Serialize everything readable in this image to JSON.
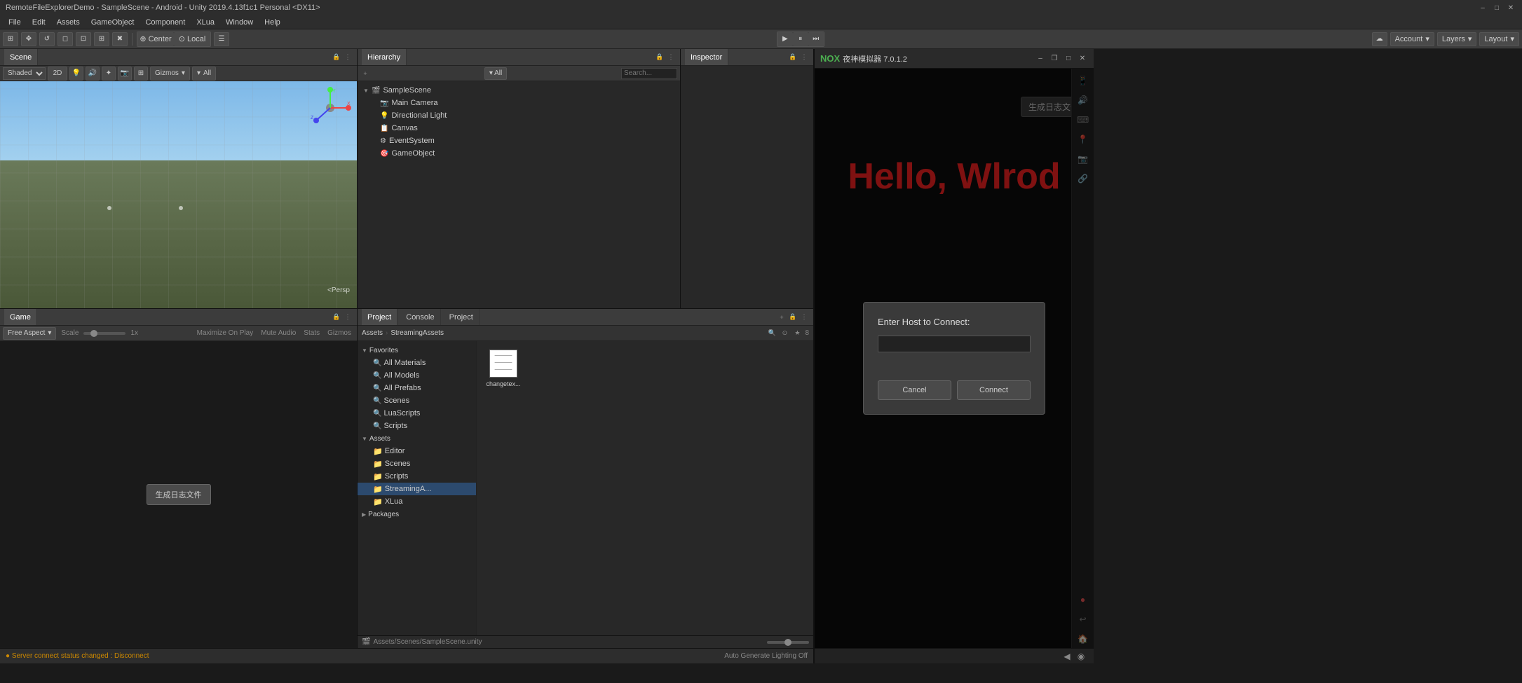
{
  "titlebar": {
    "title": "RemoteFileExplorerDemo - SampleScene - Android - Unity 2019.4.13f1c1 Personal <DX11>",
    "minimize": "–",
    "maximize": "□",
    "close": "✕"
  },
  "menubar": {
    "items": [
      "File",
      "Edit",
      "Assets",
      "GameObject",
      "Component",
      "XLua",
      "Window",
      "Help"
    ]
  },
  "toolbar": {
    "play_label": "▶",
    "pause_label": "⏸",
    "step_label": "⏭",
    "center_label": "Center",
    "local_label": "Local"
  },
  "top_controls": {
    "account_label": "Account",
    "layers_label": "Layers",
    "layout_label": "Layout"
  },
  "scene_panel": {
    "tab_label": "Scene",
    "view_mode": "Shaded",
    "dim": "2D",
    "gizmos_label": "Gizmos",
    "all_label": "All",
    "persp_label": "<Persp"
  },
  "hierarchy_panel": {
    "tab_label": "Hierarchy",
    "items": [
      {
        "label": "SampleScene",
        "indent": 0,
        "arrow": "▼",
        "icon": "🎬"
      },
      {
        "label": "Main Camera",
        "indent": 1,
        "arrow": "",
        "icon": "📷"
      },
      {
        "label": "Directional Light",
        "indent": 1,
        "arrow": "",
        "icon": "💡"
      },
      {
        "label": "Canvas",
        "indent": 1,
        "arrow": "",
        "icon": "📋"
      },
      {
        "label": "EventSystem",
        "indent": 1,
        "arrow": "",
        "icon": "⚙"
      },
      {
        "label": "GameObject",
        "indent": 1,
        "arrow": "",
        "icon": "🎯"
      }
    ]
  },
  "inspector_panel": {
    "tab_label": "Inspector"
  },
  "game_panel": {
    "tab_label": "Game",
    "aspect_label": "Free Aspect",
    "scale_label": "Scale",
    "scale_value": "1x",
    "maximize_label": "Maximize On Play",
    "mute_label": "Mute Audio",
    "stats_label": "Stats",
    "gizmos_label": "Gizmos",
    "generate_btn": "生成日志文件"
  },
  "project_panel": {
    "tabs": [
      "Project",
      "Console",
      "Project"
    ],
    "active_tab": "Project",
    "favorites": {
      "label": "Favorites",
      "items": [
        "All Materials",
        "All Models",
        "All Prefabs",
        "Scenes",
        "LuaScripts",
        "Scripts"
      ]
    },
    "assets": {
      "label": "Assets",
      "items": [
        {
          "label": "Editor",
          "indent": 1
        },
        {
          "label": "Scenes",
          "indent": 1
        },
        {
          "label": "Scripts",
          "indent": 1
        },
        {
          "label": "StreamingA...",
          "indent": 1,
          "selected": true
        },
        {
          "label": "XLua",
          "indent": 1
        }
      ]
    },
    "packages": {
      "label": "Packages",
      "items": []
    },
    "breadcrumb": {
      "root": "Assets",
      "child": "StreamingAssets"
    },
    "file": {
      "name": "changetex...",
      "icon_lines": [
        "─────",
        "─────",
        "─────"
      ]
    }
  },
  "status_bar": {
    "message": "● Server connect status changed : Disconnect",
    "right": "Auto Generate Lighting Off"
  },
  "nox": {
    "logo": "NOX",
    "title": "夜神模拟器 7.0.1.2",
    "hello_text": "Hello, Wlrod",
    "generate_btn": "生成日志文件",
    "dialog": {
      "title": "Enter Host to Connect:",
      "cancel_label": "Cancel",
      "connect_label": "Connect"
    },
    "bottom_btns": [
      "◀",
      "◉"
    ]
  }
}
